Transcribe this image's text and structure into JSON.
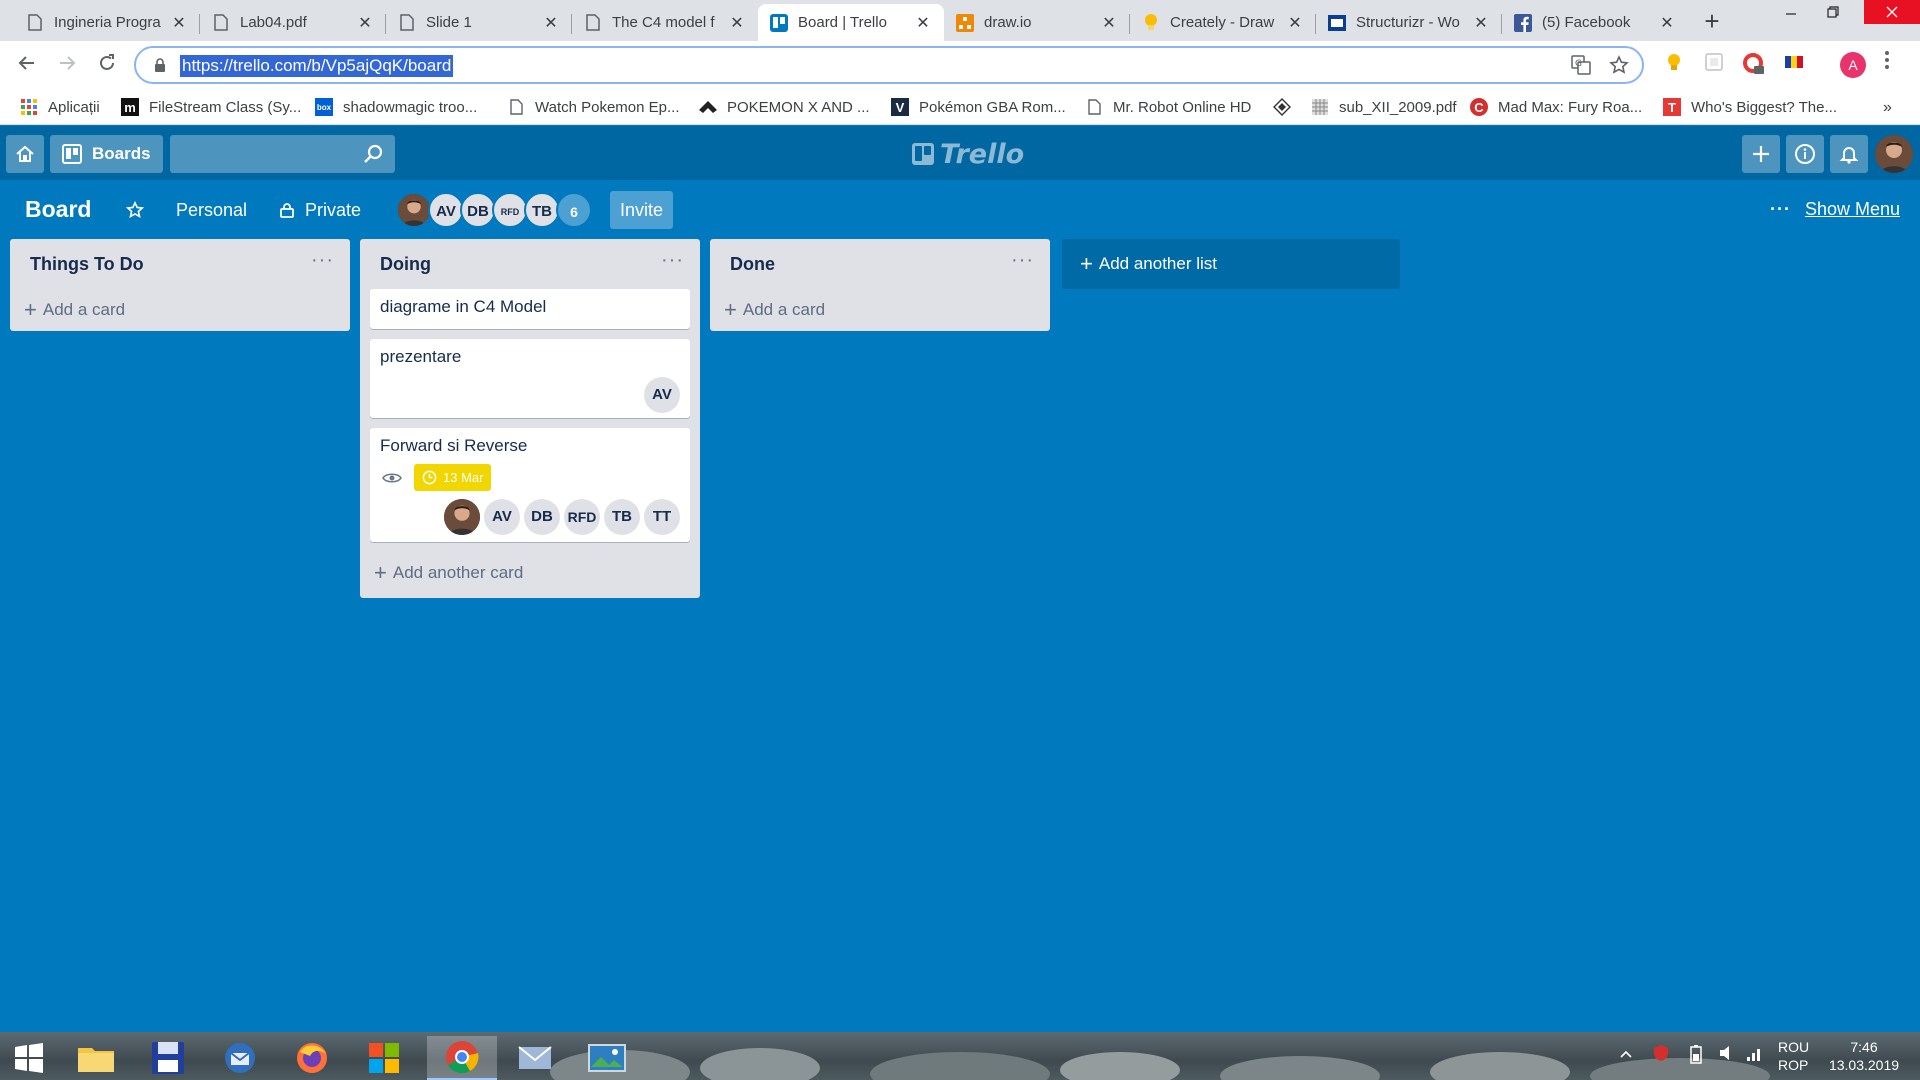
{
  "browser": {
    "tabs": [
      {
        "title": "Ingineria Progra",
        "icon": "document-icon"
      },
      {
        "title": "Lab04.pdf",
        "icon": "document-icon"
      },
      {
        "title": "Slide 1",
        "icon": "document-icon"
      },
      {
        "title": "The C4 model f",
        "icon": "document-icon"
      },
      {
        "title": "Board | Trello",
        "icon": "trello-icon",
        "active": true
      },
      {
        "title": "draw.io",
        "icon": "drawio-icon"
      },
      {
        "title": "Creately - Draw",
        "icon": "lightbulb-icon"
      },
      {
        "title": "Structurizr - Wo",
        "icon": "structurizr-icon"
      },
      {
        "title": "(5) Facebook",
        "icon": "facebook-icon"
      }
    ],
    "close_glyph": "✕",
    "new_tab_glyph": "+",
    "url": "https://trello.com/b/Vp5ajQqK/board",
    "profile_initial": "A",
    "bookmarks": [
      {
        "label": "Aplicații",
        "icon": "apps-grid-icon"
      },
      {
        "label": "FileStream Class (Sy...",
        "icon": "m-icon"
      },
      {
        "label": "shadowmagic troo...",
        "icon": "box-icon"
      },
      {
        "label": "Watch Pokemon Ep...",
        "icon": "page-icon"
      },
      {
        "label": "POKEMON X AND ...",
        "icon": "bird-icon"
      },
      {
        "label": "Pokémon GBA Rom...",
        "icon": "v-icon"
      },
      {
        "label": "Mr. Robot Online HD",
        "icon": "page-icon"
      },
      {
        "label": "",
        "icon": "diamond-icon"
      },
      {
        "label": "sub_XII_2009.pdf",
        "icon": "grid-icon"
      },
      {
        "label": "Mad Max: Fury Roa...",
        "icon": "c-icon"
      },
      {
        "label": "Who's Biggest? The...",
        "icon": "t-icon"
      }
    ],
    "more_glyph": "»"
  },
  "trello": {
    "header": {
      "boards_label": "Boards",
      "logo_text": "Trello"
    },
    "board": {
      "title": "Board",
      "team": "Personal",
      "visibility": "Private",
      "members": [
        "AV",
        "DB",
        "RFD",
        "TB"
      ],
      "extra_count": "6",
      "invite_label": "Invite",
      "menu_dots": "···",
      "show_menu_label": "Show Menu"
    },
    "lists": [
      {
        "title": "Things To Do",
        "cards": [],
        "add_label": "Add a card"
      },
      {
        "title": "Doing",
        "cards": [
          {
            "title": "diagrame in C4 Model"
          },
          {
            "title": "prezentare",
            "members": [
              "AV"
            ]
          },
          {
            "title": "Forward si Reverse",
            "due": "13 Mar",
            "members": [
              "AV",
              "DB",
              "RFD",
              "TB",
              "TT"
            ]
          }
        ],
        "add_label": "Add another card"
      },
      {
        "title": "Done",
        "cards": [],
        "add_label": "Add a card"
      }
    ],
    "add_list_label": "Add another list",
    "list_menu_glyph": "···"
  },
  "taskbar": {
    "lang_line1": "ROU",
    "lang_line2": "ROP",
    "time": "7:46",
    "date": "13.03.2019"
  },
  "colors": {
    "board_bg": "#0079bf",
    "header_bg": "#0067a3",
    "due_badge": "#f2d600"
  }
}
